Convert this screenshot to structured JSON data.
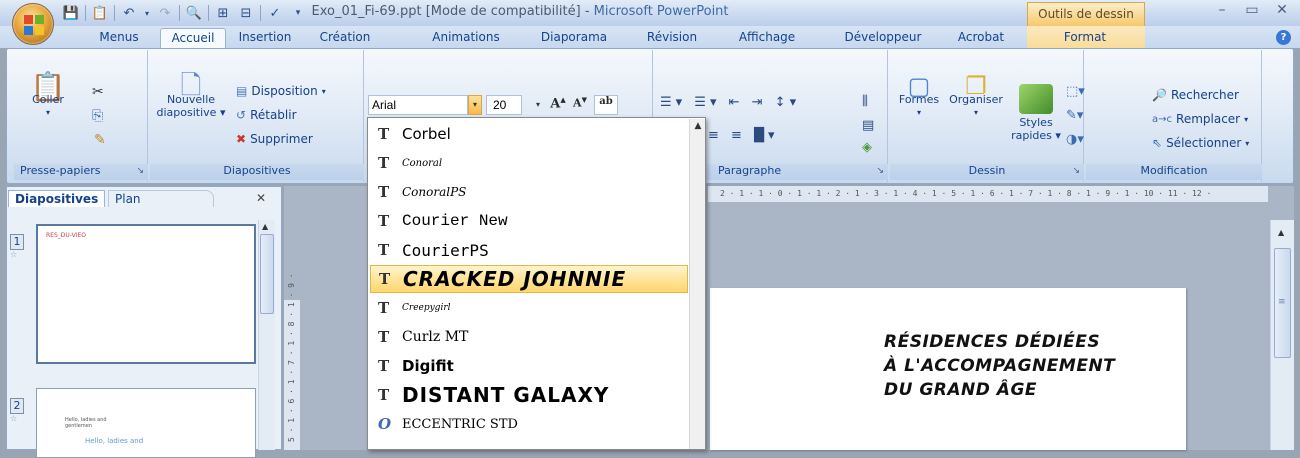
{
  "window": {
    "title_file": "Exo_01_Fi-69.ppt [Mode de compatibilité] - ",
    "title_app": "Microsoft PowerPoint",
    "contextual_tab": "Outils de dessin"
  },
  "tabs": [
    "Menus",
    "Accueil",
    "Insertion",
    "Création",
    "Animations",
    "Diaporama",
    "Révision",
    "Affichage",
    "Développeur",
    "Acrobat",
    "Format"
  ],
  "active_tab": "Accueil",
  "ribbon": {
    "clipboard": {
      "paste": "Coller",
      "group": "Presse-papiers"
    },
    "slides": {
      "new_slide_line1": "Nouvelle",
      "new_slide_line2": "diapositive",
      "layout": "Disposition",
      "reset": "Rétablir",
      "delete": "Supprimer",
      "group": "Diapositives"
    },
    "font": {
      "name": "Arial",
      "size": "20"
    },
    "paragraph": {
      "group": "Paragraphe"
    },
    "drawing": {
      "shapes": "Formes",
      "arrange": "Organiser",
      "styles_line1": "Styles",
      "styles_line2": "rapides",
      "group": "Dessin"
    },
    "editing": {
      "find": "Rechercher",
      "replace": "Remplacer",
      "select": "Sélectionner",
      "group": "Modification"
    }
  },
  "font_dropdown": {
    "items": [
      "Corbel",
      "Conoral",
      "ConoralPS",
      "Courier New",
      "CourierPS",
      "Cracked Johnnie",
      "Creepygirl",
      "Curlz MT",
      "Digifit",
      "Distant Galaxy",
      "Eccentric Std"
    ],
    "highlighted": "Cracked Johnnie"
  },
  "left_pane": {
    "tab_slides": "Diapositives",
    "tab_outline": "Plan",
    "slide1_number": "1",
    "slide2_number": "2",
    "slide1_text": "RES_DU-VIEO",
    "slide2_small": "Hello, ladies and gentlemen",
    "slide2_text": "Hello, ladies and"
  },
  "ruler": {
    "horizontal": "2 · 1 · 1 · 0 · 1 · 1 · 2 · 1 · 3 · 1 · 4 · 1 · 5 · 1 · 6 · 1 · 7 · 1 · 8 · 1 · 9 · 1 · 10 · 11 · 12 ·",
    "vertical": "5 · 1 · 6 · 1 · 7 · 1 · 8 · 1 · 9 ·"
  },
  "slide": {
    "title_lines": [
      "RÉSIDENCES DÉDIÉES",
      "À L'ACCOMPAGNEMENT",
      "DU GRAND ÂGE"
    ]
  },
  "colors": {
    "ribbon_blue": "#15428b",
    "highlight": "#ffd66d",
    "office_orange": "#eaa73a"
  }
}
